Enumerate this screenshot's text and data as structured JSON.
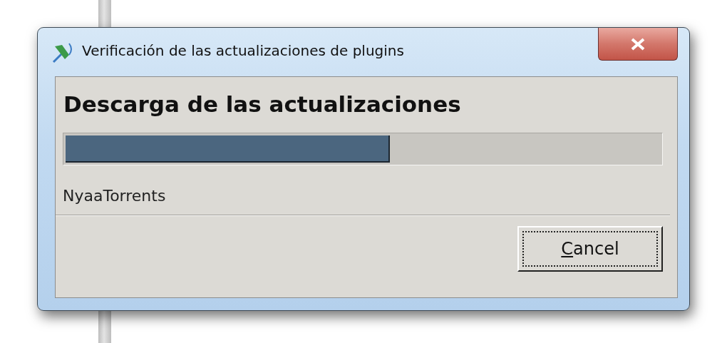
{
  "window": {
    "title": "Verificación de las actualizaciones de plugins"
  },
  "heading": "Descarga de las actualizaciones",
  "progress": {
    "level": 0.545
  },
  "status": "NyaaTorrents",
  "buttons": [
    {
      "label": "Cancel",
      "first_letter_underlined": true,
      "focused": true
    }
  ]
}
